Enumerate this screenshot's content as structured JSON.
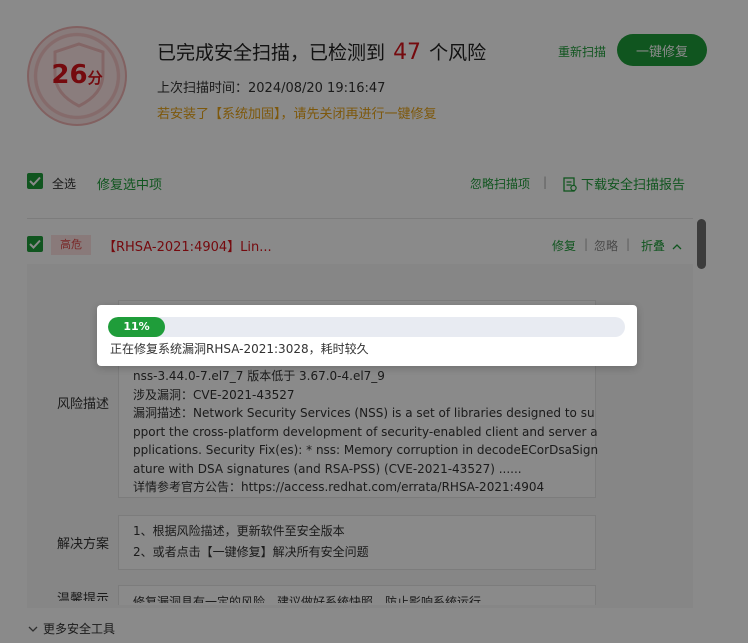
{
  "header": {
    "score": "26",
    "score_unit": "分",
    "title_prefix": "已完成安全扫描，已检测到",
    "risk_count": "47",
    "title_suffix": "个风险",
    "last_scan": "上次扫描时间：2024/08/20 19:16:47",
    "warning": "若安装了【系统加固】，请先关闭再进行一键修复",
    "rescan_label": "重新扫描",
    "fix_all_label": "一键修复"
  },
  "toolbar": {
    "select_all_label": "全选",
    "fix_selected_label": "修复选中项",
    "ignore_items_label": "忽略扫描项",
    "separator": "|",
    "report_label": "下载安全扫描报告"
  },
  "item": {
    "level": "高危",
    "title": "【RHSA-2021:4904】Lin...",
    "fix_label": "修复",
    "ignore_label": "忽略",
    "collapse_label": "折叠",
    "sep": "|"
  },
  "detail": {
    "risk_desc_label": "风险描述",
    "risk_desc_lines": [
      "nss-3.44.0-7.el7_7 版本低于 3.67.0-4.el7_9",
      "涉及漏洞：CVE-2021-43527",
      "漏洞描述：Network Security Services (NSS) is a set of libraries designed to su",
      "pport the cross-platform development of security-enabled client and server a",
      "pplications. Security Fix(es): * nss: Memory corruption in decodeECorDsaSign",
      "ature with DSA signatures (and RSA-PSS) (CVE-2021-43527) ......",
      "详情参考官方公告：https://access.redhat.com/errata/RHSA-2021:4904"
    ],
    "solution_label": "解决方案",
    "solution_lines": [
      "1、根据风险描述，更新软件至安全版本",
      "2、或者点击【一键修复】解决所有安全问题"
    ],
    "tip_label": "温馨提示",
    "tip_text": "修复漏洞具有一定的风险，建议做好系统快照，防止影响系统运行"
  },
  "footer": {
    "more_tools_label": "更多安全工具"
  },
  "progress": {
    "percent_value": 0.11,
    "percent_label": "11%",
    "status_text": "正在修复系统漏洞RHSA-2021:3028，耗时较久"
  }
}
